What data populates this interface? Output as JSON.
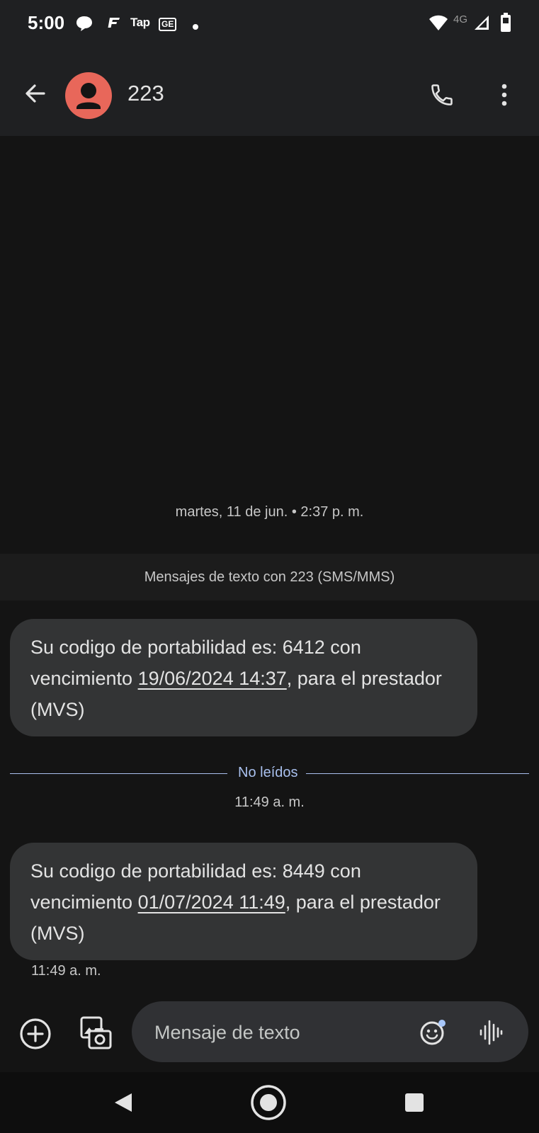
{
  "status_bar": {
    "time": "5:00",
    "notification_icons": [
      "chat-bubble-icon",
      "f-app-icon",
      "tap-app-icon",
      "ge-app-icon",
      "dot-icon"
    ],
    "tap_label": "Tap",
    "ge_label": "GE",
    "network_label": "4G",
    "system_icons": [
      "wifi-icon",
      "signal-icon",
      "battery-icon"
    ]
  },
  "header": {
    "contact_name": "223",
    "avatar_color": "#e8675a",
    "actions": [
      "back-arrow-icon",
      "phone-icon",
      "more-vert-icon"
    ]
  },
  "conversation": {
    "date_header": "martes, 11 de jun. • 2:37 p. m.",
    "info_banner": "Mensajes de texto con 223 (SMS/MMS)",
    "messages": [
      {
        "text_before": "Su codigo de portabilidad es: 6412 con vencimiento ",
        "link": "19/06/2024 14:37",
        "text_after": ", para el prestador (MVS)"
      },
      {
        "text_before": "Su codigo de portabilidad es: 8449 con vencimiento ",
        "link": "01/07/2024 11:49",
        "text_after": ", para el prestador (MVS)",
        "timestamp": "11:49 a. m."
      }
    ],
    "unread_divider": "No leídos",
    "unread_time": "11:49 a. m."
  },
  "composer": {
    "placeholder": "Mensaje de texto",
    "buttons": [
      "add-circle-icon",
      "gallery-icon",
      "emoji-icon",
      "voice-icon"
    ]
  },
  "nav_bar": {
    "buttons": [
      "nav-back-icon",
      "nav-home-icon",
      "nav-recents-icon"
    ]
  },
  "colors": {
    "background": "#141414",
    "app_bar": "#1f2022",
    "bubble": "#333435",
    "unread_accent": "#a9c0ee",
    "avatar": "#e8675a"
  }
}
